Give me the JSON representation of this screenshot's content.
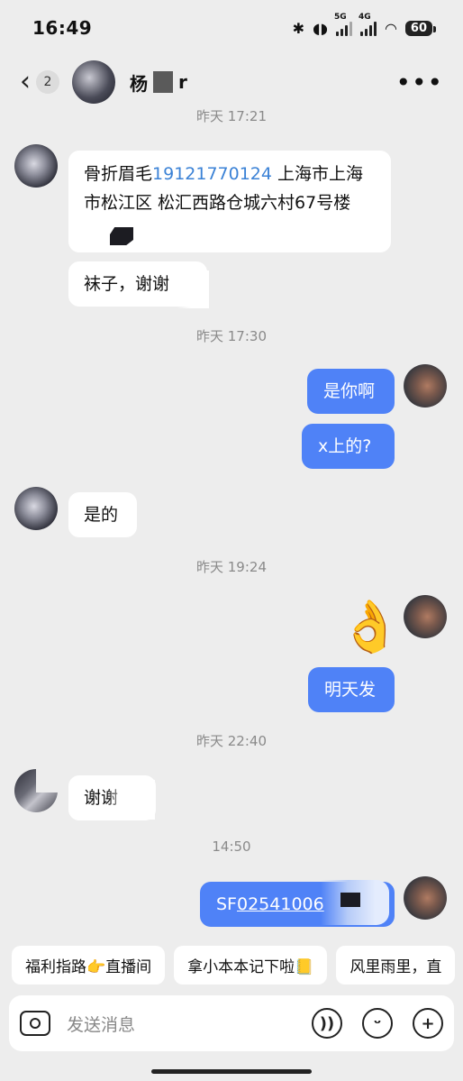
{
  "status": {
    "time": "16:49",
    "net1": "5G",
    "net2": "4G",
    "battery": "60"
  },
  "header": {
    "back_badge": "2",
    "name_left": "杨",
    "name_right": "r"
  },
  "timestamps": [
    "昨天 17:21",
    "昨天 17:30",
    "昨天 19:24",
    "昨天 22:40",
    "14:50"
  ],
  "messages": {
    "m1_pre": "骨折眉毛",
    "m1_phone": "19121770124",
    "m1_post": " 上海市上海",
    "m1_line2": "市松江区 松汇西路仓城六村67号楼",
    "m2": "袜子，谢谢",
    "m3": "是你啊",
    "m4": "x上的?",
    "m5": "是的",
    "m6_emoji": "👌",
    "m7": "明天发",
    "m8": "谢谢",
    "m9_prefix": "SF",
    "m9_link": "02541006"
  },
  "quick_replies": [
    "福利指路👉直播间",
    "拿小本本记下啦📒",
    "风里雨里，直"
  ],
  "input": {
    "placeholder": "发送消息"
  },
  "colors": {
    "accent": "#4f82f7",
    "link": "#3b82d6",
    "background": "#ededed"
  }
}
